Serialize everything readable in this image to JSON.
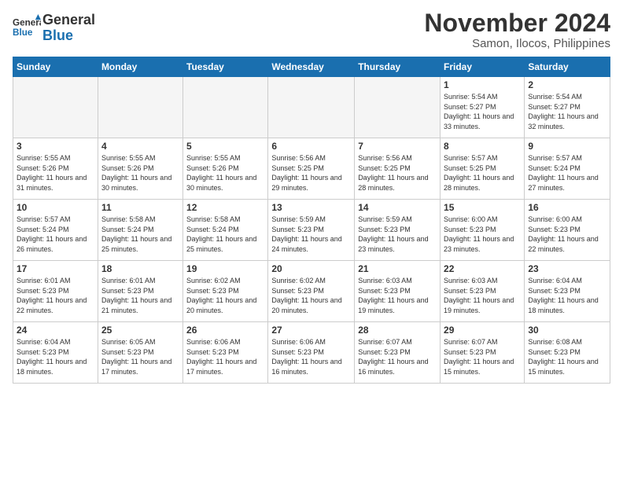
{
  "logo": {
    "line1": "General",
    "line2": "Blue"
  },
  "header": {
    "month": "November 2024",
    "location": "Samon, Ilocos, Philippines"
  },
  "weekdays": [
    "Sunday",
    "Monday",
    "Tuesday",
    "Wednesday",
    "Thursday",
    "Friday",
    "Saturday"
  ],
  "weeks": [
    [
      {
        "day": "",
        "empty": true
      },
      {
        "day": "",
        "empty": true
      },
      {
        "day": "",
        "empty": true
      },
      {
        "day": "",
        "empty": true
      },
      {
        "day": "",
        "empty": true
      },
      {
        "day": "1",
        "sunrise": "5:54 AM",
        "sunset": "5:27 PM",
        "daylight": "11 hours and 33 minutes."
      },
      {
        "day": "2",
        "sunrise": "5:54 AM",
        "sunset": "5:27 PM",
        "daylight": "11 hours and 32 minutes."
      }
    ],
    [
      {
        "day": "3",
        "sunrise": "5:55 AM",
        "sunset": "5:26 PM",
        "daylight": "11 hours and 31 minutes."
      },
      {
        "day": "4",
        "sunrise": "5:55 AM",
        "sunset": "5:26 PM",
        "daylight": "11 hours and 30 minutes."
      },
      {
        "day": "5",
        "sunrise": "5:55 AM",
        "sunset": "5:26 PM",
        "daylight": "11 hours and 30 minutes."
      },
      {
        "day": "6",
        "sunrise": "5:56 AM",
        "sunset": "5:25 PM",
        "daylight": "11 hours and 29 minutes."
      },
      {
        "day": "7",
        "sunrise": "5:56 AM",
        "sunset": "5:25 PM",
        "daylight": "11 hours and 28 minutes."
      },
      {
        "day": "8",
        "sunrise": "5:57 AM",
        "sunset": "5:25 PM",
        "daylight": "11 hours and 28 minutes."
      },
      {
        "day": "9",
        "sunrise": "5:57 AM",
        "sunset": "5:24 PM",
        "daylight": "11 hours and 27 minutes."
      }
    ],
    [
      {
        "day": "10",
        "sunrise": "5:57 AM",
        "sunset": "5:24 PM",
        "daylight": "11 hours and 26 minutes."
      },
      {
        "day": "11",
        "sunrise": "5:58 AM",
        "sunset": "5:24 PM",
        "daylight": "11 hours and 25 minutes."
      },
      {
        "day": "12",
        "sunrise": "5:58 AM",
        "sunset": "5:24 PM",
        "daylight": "11 hours and 25 minutes."
      },
      {
        "day": "13",
        "sunrise": "5:59 AM",
        "sunset": "5:23 PM",
        "daylight": "11 hours and 24 minutes."
      },
      {
        "day": "14",
        "sunrise": "5:59 AM",
        "sunset": "5:23 PM",
        "daylight": "11 hours and 23 minutes."
      },
      {
        "day": "15",
        "sunrise": "6:00 AM",
        "sunset": "5:23 PM",
        "daylight": "11 hours and 23 minutes."
      },
      {
        "day": "16",
        "sunrise": "6:00 AM",
        "sunset": "5:23 PM",
        "daylight": "11 hours and 22 minutes."
      }
    ],
    [
      {
        "day": "17",
        "sunrise": "6:01 AM",
        "sunset": "5:23 PM",
        "daylight": "11 hours and 22 minutes."
      },
      {
        "day": "18",
        "sunrise": "6:01 AM",
        "sunset": "5:23 PM",
        "daylight": "11 hours and 21 minutes."
      },
      {
        "day": "19",
        "sunrise": "6:02 AM",
        "sunset": "5:23 PM",
        "daylight": "11 hours and 20 minutes."
      },
      {
        "day": "20",
        "sunrise": "6:02 AM",
        "sunset": "5:23 PM",
        "daylight": "11 hours and 20 minutes."
      },
      {
        "day": "21",
        "sunrise": "6:03 AM",
        "sunset": "5:23 PM",
        "daylight": "11 hours and 19 minutes."
      },
      {
        "day": "22",
        "sunrise": "6:03 AM",
        "sunset": "5:23 PM",
        "daylight": "11 hours and 19 minutes."
      },
      {
        "day": "23",
        "sunrise": "6:04 AM",
        "sunset": "5:23 PM",
        "daylight": "11 hours and 18 minutes."
      }
    ],
    [
      {
        "day": "24",
        "sunrise": "6:04 AM",
        "sunset": "5:23 PM",
        "daylight": "11 hours and 18 minutes."
      },
      {
        "day": "25",
        "sunrise": "6:05 AM",
        "sunset": "5:23 PM",
        "daylight": "11 hours and 17 minutes."
      },
      {
        "day": "26",
        "sunrise": "6:06 AM",
        "sunset": "5:23 PM",
        "daylight": "11 hours and 17 minutes."
      },
      {
        "day": "27",
        "sunrise": "6:06 AM",
        "sunset": "5:23 PM",
        "daylight": "11 hours and 16 minutes."
      },
      {
        "day": "28",
        "sunrise": "6:07 AM",
        "sunset": "5:23 PM",
        "daylight": "11 hours and 16 minutes."
      },
      {
        "day": "29",
        "sunrise": "6:07 AM",
        "sunset": "5:23 PM",
        "daylight": "11 hours and 15 minutes."
      },
      {
        "day": "30",
        "sunrise": "6:08 AM",
        "sunset": "5:23 PM",
        "daylight": "11 hours and 15 minutes."
      }
    ]
  ]
}
